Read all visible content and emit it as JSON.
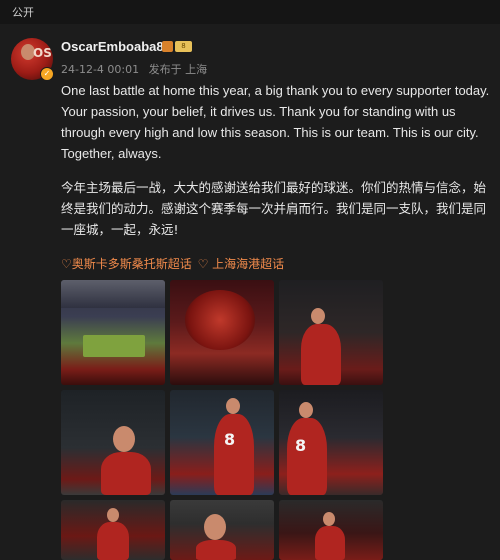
{
  "topbar": {
    "label": "公开"
  },
  "post": {
    "username": "OscarEmboaba8",
    "badge_level": "8",
    "timestamp": "24-12-4 00:01",
    "published_from": "发布于 上海",
    "text_en": "One last battle at home this year, a big thank you to every supporter today. Your passion, your belief, it drives us. Thank you for standing with us through every high and low this season. This is our team. This is our city. Together, always.",
    "text_zh": "今年主场最后一战，大大的感谢送给我们最好的球迷。你们的热情与信念，始终是我们的动力。感谢这个赛季每一次并肩而行。我们是同一支队，我们是同一座城，一起，永远!",
    "topics": [
      "♡奥斯卡多斯桑托斯超话",
      "♡ 上海海港超话"
    ]
  },
  "photos": [
    {
      "jersey": ""
    },
    {
      "jersey": ""
    },
    {
      "jersey": ""
    },
    {
      "jersey": ""
    },
    {
      "jersey": "8"
    },
    {
      "jersey": "8"
    },
    {
      "jersey": ""
    },
    {
      "jersey": ""
    },
    {
      "jersey": ""
    }
  ],
  "colors": {
    "accent": "#f08a4b",
    "background": "#1c1c1c",
    "text": "#e8e8e8",
    "meta": "#8d8d8d"
  },
  "icons": [
    "lock-icon",
    "verified-badge-icon",
    "level-badge-icon",
    "topic-icon"
  ]
}
